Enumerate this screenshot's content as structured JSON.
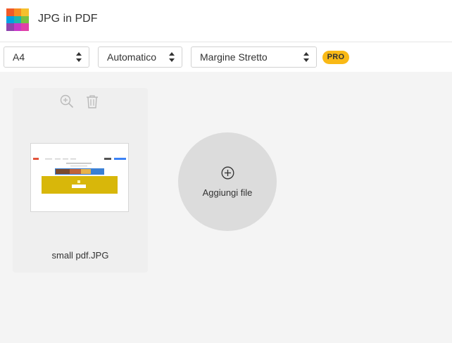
{
  "header": {
    "title": "JPG in PDF",
    "logo_icon": "colorful-grid-logo",
    "logo_colors": [
      "#f05a28",
      "#f78d1f",
      "#f6c02d",
      "#00a0e3",
      "#1fb5ad",
      "#7ac143",
      "#8e44ad",
      "#c837c8",
      "#e040a8"
    ]
  },
  "toolbar": {
    "page_size": "A4",
    "orientation": "Automatico",
    "margin": "Margine Stretto",
    "pro_badge": "PRO"
  },
  "file_card": {
    "file_name": "small pdf.JPG",
    "zoom_icon": "zoom-in-icon",
    "delete_icon": "trash-icon"
  },
  "add_file": {
    "label": "Aggiungi file",
    "icon": "plus-circle-icon"
  },
  "colors": {
    "accent": "#f9b916",
    "background": "#f4f4f4",
    "card": "#efefef",
    "add_circle": "#dcdcdc"
  }
}
